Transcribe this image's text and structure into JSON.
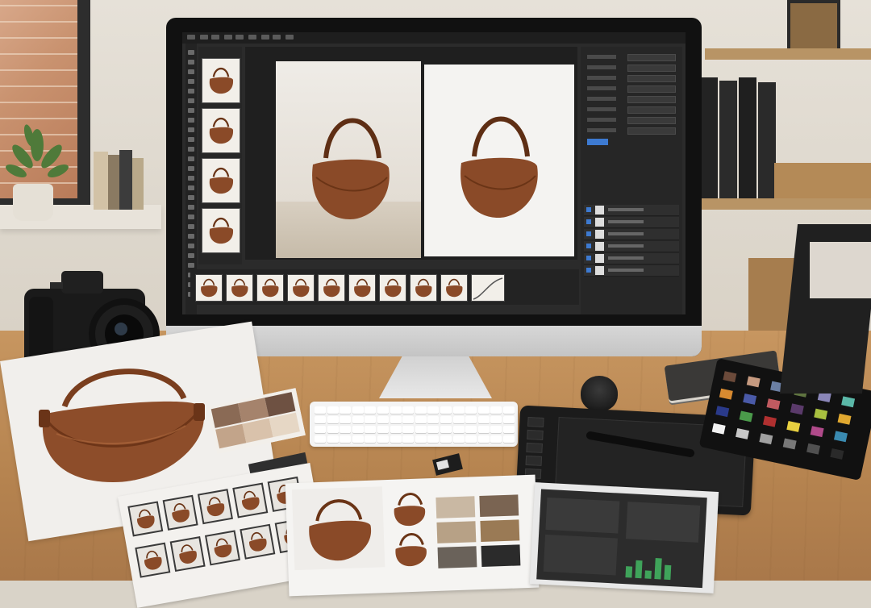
{
  "scene": {
    "description_label": "",
    "colors": {
      "wall": "#e0dacf",
      "desk_wood": "#c08e5a",
      "leather": "#8a4a28",
      "app_background": "#2b2b2b",
      "accent_blue": "#3d7ad1"
    }
  },
  "photo_editor": {
    "filmstrip_vertical_count": 4,
    "filmstrip_horizontal_count": 9,
    "layer_count": 6
  },
  "desk_items": {
    "camera_icon": "camera-icon",
    "keyboard_icon": "keyboard-icon",
    "tablet_icon": "drawing-tablet-icon",
    "pen_icon": "stylus-icon",
    "sdcard_icon": "sd-card-icon",
    "color_checker_icon": "color-checker-icon"
  },
  "color_checker": {
    "patches": [
      "#6b4a3a",
      "#c69a80",
      "#6b7fa3",
      "#5f7440",
      "#8a86b8",
      "#5bb8a8",
      "#d88a30",
      "#4a5aa8",
      "#c05a60",
      "#5a3a6a",
      "#a8c040",
      "#e0a830",
      "#2a3a8a",
      "#4a9a4a",
      "#b03030",
      "#e8d040",
      "#b04a8a",
      "#3a8ab0",
      "#f2f2f2",
      "#c8c8c8",
      "#a0a0a0",
      "#787878",
      "#505050",
      "#2a2a2a"
    ]
  },
  "swatches": {
    "card": [
      "#8a6a55",
      "#a5836c",
      "#c2a48a",
      "#d9c2ab",
      "#e6d7c5",
      "#6e5142"
    ],
    "print_mid": [
      "#c9b8a3",
      "#7a6452",
      "#b7a186",
      "#9a7a55",
      "#6a625a",
      "#2b2b2b"
    ]
  }
}
